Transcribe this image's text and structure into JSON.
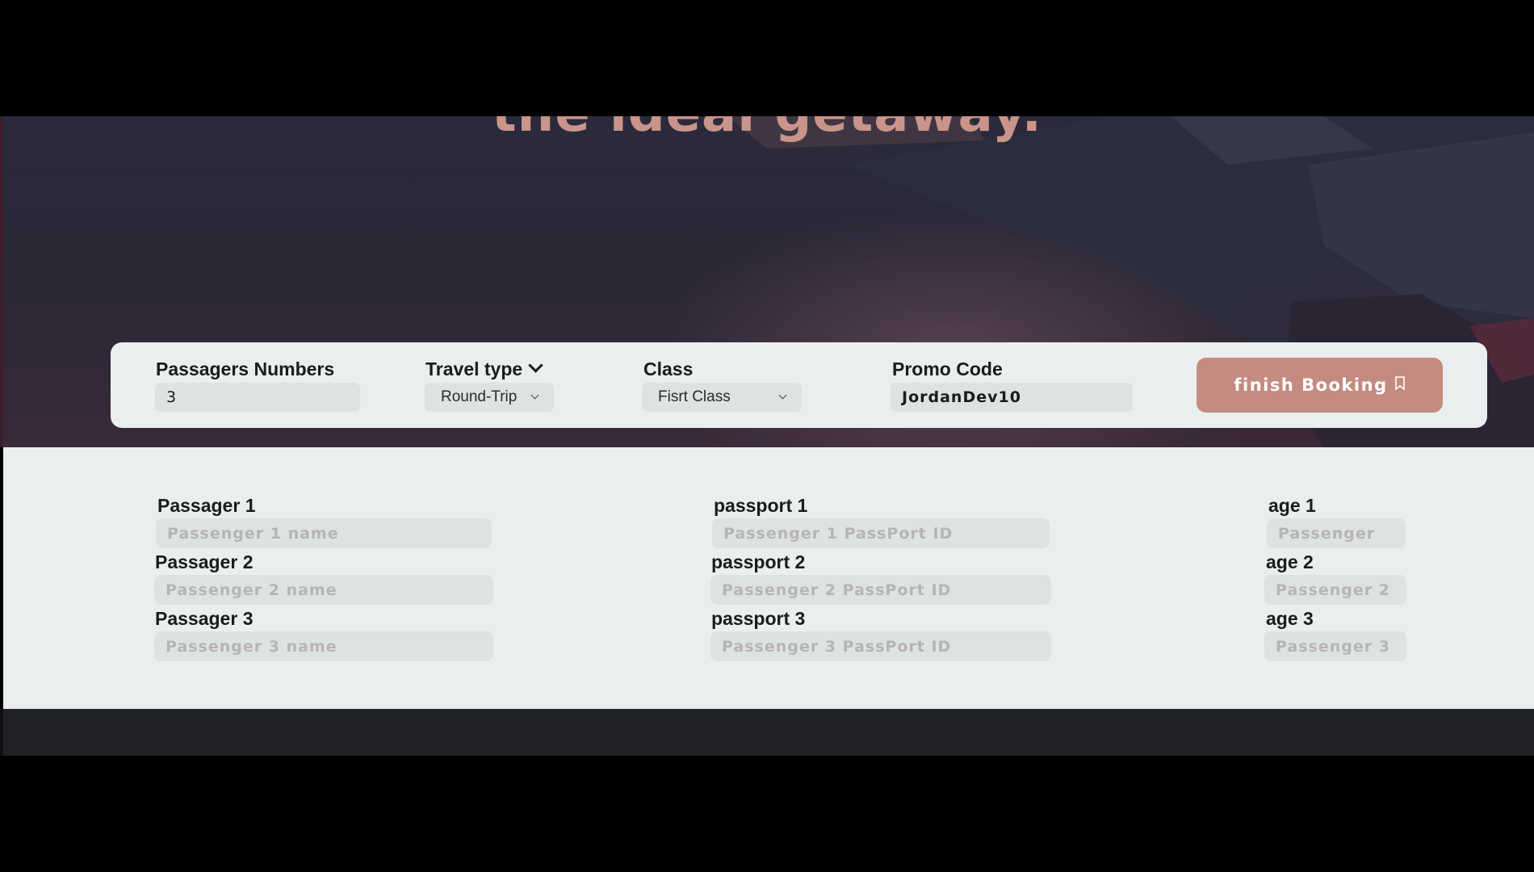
{
  "hero": {
    "title_fragment": "the ideal getaway."
  },
  "booking": {
    "passengers_label": "Passagers Numbers",
    "passengers_value": "3",
    "travel_type_label": "Travel type",
    "travel_type_value": "Round-Trip",
    "class_label": "Class",
    "class_value": "Fisrt Class",
    "promo_label": "Promo Code",
    "promo_value": "JordanDev10",
    "finish_button": "finish Booking"
  },
  "passengers": [
    {
      "name_label": "Passager 1",
      "name_placeholder": "Passenger 1 name",
      "passport_label": "passport 1",
      "passport_placeholder": "Passenger 1 PassPort ID",
      "age_label": "age 1",
      "age_placeholder": "Passenger"
    },
    {
      "name_label": "Passager 2",
      "name_placeholder": "Passenger 2 name",
      "passport_label": "passport 2",
      "passport_placeholder": "Passenger 2 PassPort ID",
      "age_label": "age 2",
      "age_placeholder": "Passenger 2"
    },
    {
      "name_label": "Passager 3",
      "name_placeholder": "Passenger 3 name",
      "passport_label": "passport 3",
      "passport_placeholder": "Passenger 3 PassPort ID",
      "age_label": "age 3",
      "age_placeholder": "Passenger 3"
    }
  ],
  "colors": {
    "accent": "#c48b80",
    "panel": "#e9efee",
    "input": "#dde3e2",
    "footer": "#202226"
  },
  "icons": {
    "travel_type": "chevron-down-icon",
    "finish": "bookmark-icon"
  }
}
